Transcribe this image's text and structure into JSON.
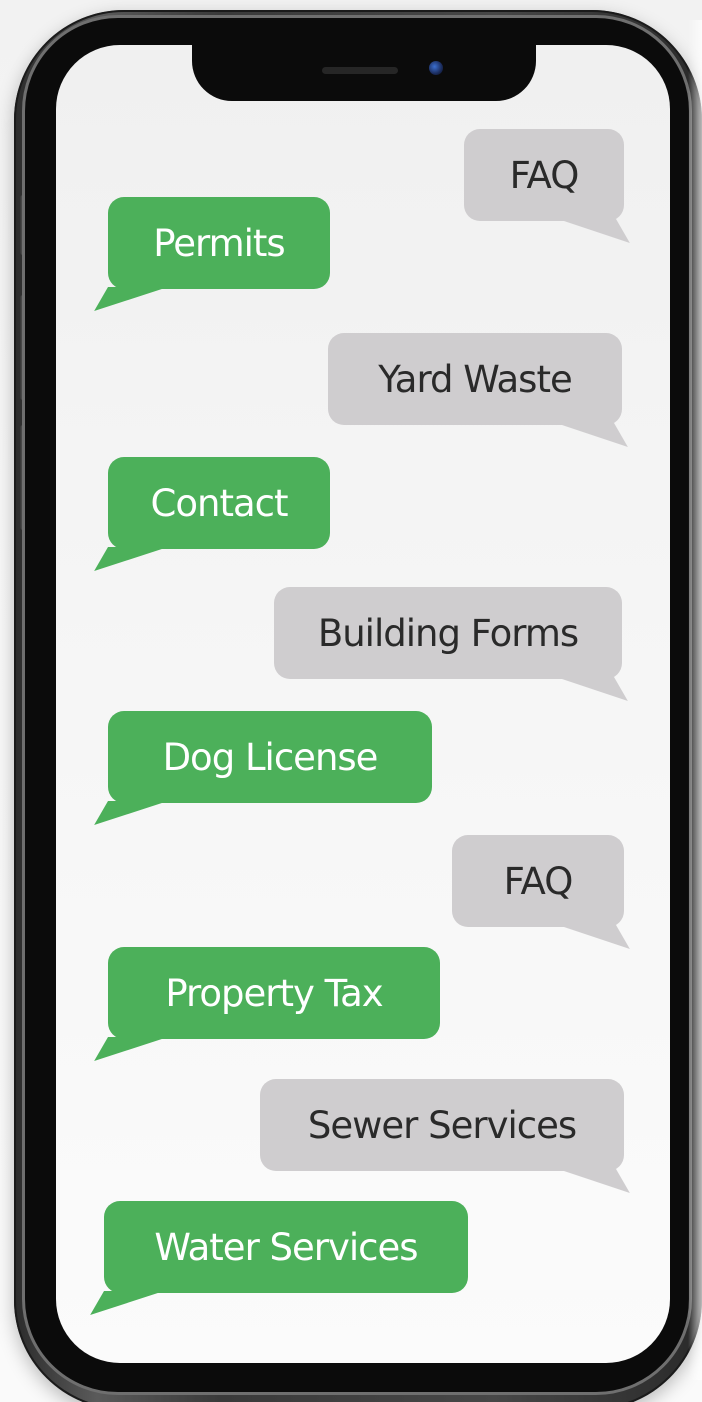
{
  "chat": {
    "bubbles": [
      {
        "label": "FAQ",
        "style": "gray"
      },
      {
        "label": "Permits",
        "style": "green"
      },
      {
        "label": "Yard Waste",
        "style": "gray"
      },
      {
        "label": "Contact",
        "style": "green"
      },
      {
        "label": "Building Forms",
        "style": "gray"
      },
      {
        "label": "Dog License",
        "style": "green"
      },
      {
        "label": "FAQ",
        "style": "gray"
      },
      {
        "label": "Property Tax",
        "style": "green"
      },
      {
        "label": "Sewer Services",
        "style": "gray"
      },
      {
        "label": "Water Services",
        "style": "green"
      }
    ]
  },
  "colors": {
    "green_bubble": "#4cb05a",
    "gray_bubble": "#cfcdcf",
    "phone_frame": "#2f2f2f"
  }
}
